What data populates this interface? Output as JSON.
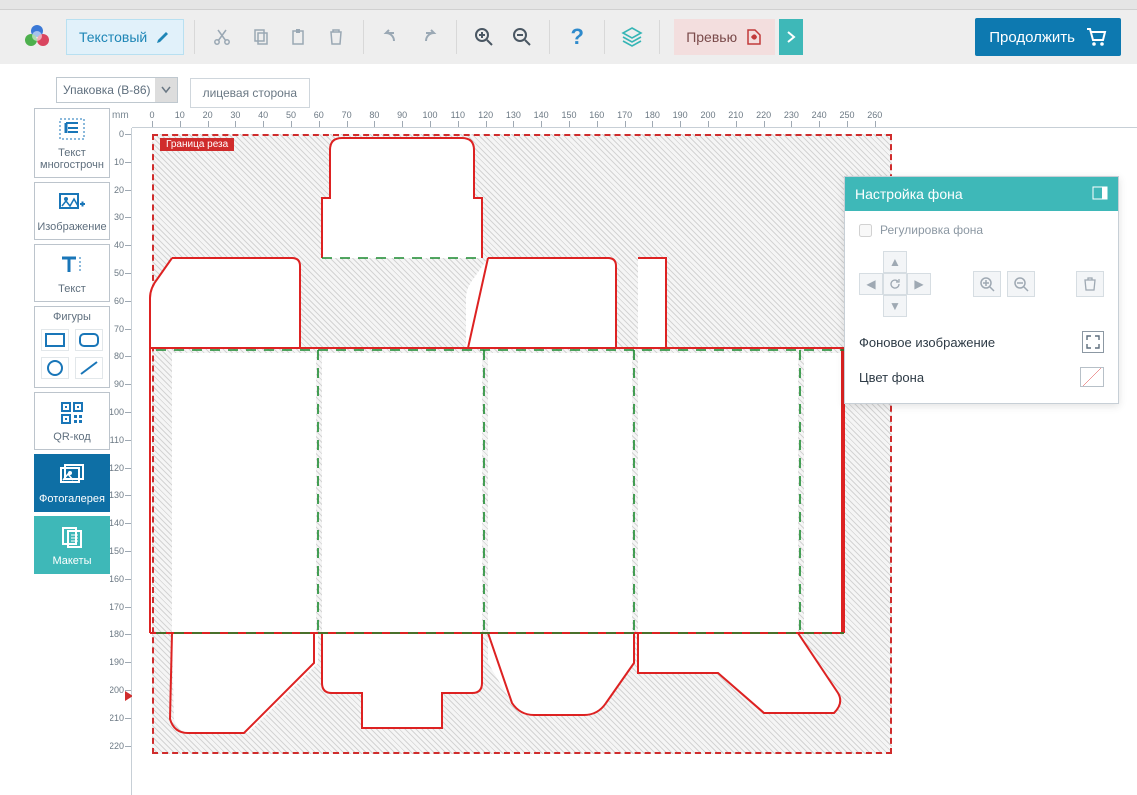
{
  "toolbar": {
    "mode_label": "Текстовый",
    "help": "?",
    "preview_label": "Превью",
    "continue_label": "Продолжить"
  },
  "tabs": {
    "package_select": "Упаковка (B-86)",
    "side_tab": "лицевая сторона"
  },
  "left_tools": {
    "text_multiline": "Текст многострочн",
    "image": "Изображение",
    "text": "Текст",
    "shapes_label": "Фигуры",
    "qr": "QR-код",
    "gallery": "Фотогалерея",
    "layouts": "Макеты"
  },
  "canvas": {
    "unit": "mm",
    "cut_label": "Граница реза",
    "h_ticks": [
      0,
      10,
      20,
      30,
      40,
      50,
      60,
      70,
      80,
      90,
      100,
      110,
      120,
      130,
      140,
      150,
      160,
      170,
      180,
      190,
      200,
      210,
      220,
      230,
      240,
      250,
      260
    ],
    "v_ticks": [
      0,
      10,
      20,
      30,
      40,
      50,
      60,
      70,
      80,
      90,
      100,
      110,
      120,
      130,
      140,
      150,
      160,
      170,
      180,
      190,
      200,
      210,
      220
    ]
  },
  "bgpanel": {
    "title": "Настройка фона",
    "adjust": "Регулировка фона",
    "bg_image": "Фоновое изображение",
    "bg_color": "Цвет фона"
  }
}
